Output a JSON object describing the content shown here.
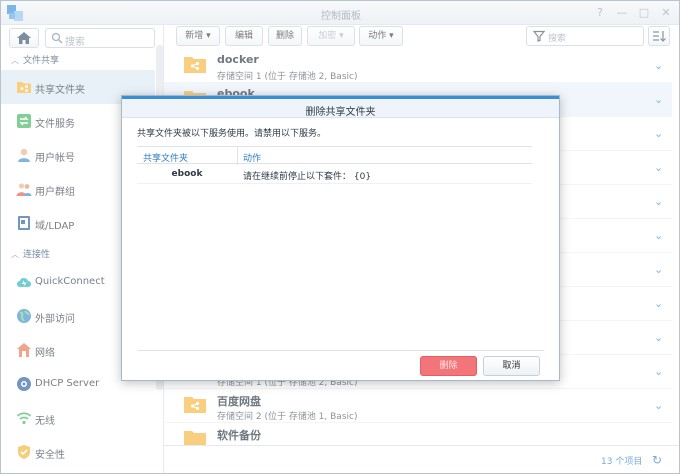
{
  "window": {
    "title": "控制面板"
  },
  "sidebar": {
    "search_placeholder": "搜索",
    "sections": [
      {
        "label": "文件共享"
      },
      {
        "label": "连接性"
      }
    ],
    "items": [
      {
        "label": "共享文件夹",
        "icon": "shared-folder-icon"
      },
      {
        "label": "文件服务",
        "icon": "file-services-icon"
      },
      {
        "label": "用户帐号",
        "icon": "user-icon"
      },
      {
        "label": "用户群组",
        "icon": "group-icon"
      },
      {
        "label": "域/LDAP",
        "icon": "ldap-icon"
      },
      {
        "label": "QuickConnect",
        "icon": "quickconnect-icon"
      },
      {
        "label": "外部访问",
        "icon": "external-access-icon"
      },
      {
        "label": "网络",
        "icon": "network-icon"
      },
      {
        "label": "DHCP Server",
        "icon": "dhcp-icon"
      },
      {
        "label": "无线",
        "icon": "wireless-icon"
      },
      {
        "label": "安全性",
        "icon": "security-icon"
      }
    ]
  },
  "toolbar": {
    "new_label": "新增",
    "edit_label": "编辑",
    "delete_label": "删除",
    "encrypt_label": "加密",
    "action_label": "动作",
    "filter_placeholder": "搜索"
  },
  "list": {
    "rows": [
      {
        "name": "docker",
        "desc": "存储空间 1 (位于 存储池 2, Basic)"
      },
      {
        "name": "ebook",
        "desc": ""
      },
      {
        "name": "",
        "desc": "存储空间 1 (位于 存储池 2, Basic)"
      },
      {
        "name": "百度网盘",
        "desc": "存储空间 2 (位于 存储池 1, Basic)"
      },
      {
        "name": "软件备份",
        "desc": ""
      }
    ]
  },
  "footer": {
    "count": "13 个项目"
  },
  "dialog": {
    "title": "删除共享文件夹",
    "message": "共享文件夹被以下服务使用。请禁用以下服务。",
    "columns": [
      "共享文件夹",
      "动作"
    ],
    "rows": [
      {
        "folder": "ebook",
        "action": "请在继续前停止以下套件： {0}"
      }
    ],
    "delete_button": "删除",
    "cancel_button": "取消"
  },
  "colors": {
    "accent": "#3a8ed6",
    "folder": "#f6b43a",
    "danger": "#f2757a",
    "active_bg": "#dce9f5"
  }
}
